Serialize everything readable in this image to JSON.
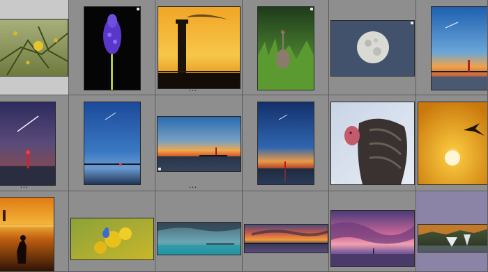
{
  "grid": {
    "cells": [
      {
        "header": "",
        "dots": ""
      },
      {
        "header": "",
        "dots": ""
      },
      {
        "header": "",
        "dots": "•••"
      },
      {
        "header": "",
        "dots": ""
      },
      {
        "header": "",
        "dots": ""
      },
      {
        "header": "",
        "dots": ""
      },
      {
        "header": "",
        "dots": "•••"
      },
      {
        "header": "",
        "dots": ""
      },
      {
        "header": "",
        "dots": "•••"
      },
      {
        "header": "",
        "dots": ""
      },
      {
        "header": "",
        "dots": ""
      },
      {
        "header": "",
        "dots": ""
      },
      {
        "header": "",
        "dots": ""
      },
      {
        "header": "",
        "dots": ""
      },
      {
        "header": "",
        "dots": ""
      },
      {
        "header": "",
        "dots": ""
      },
      {
        "header": "",
        "dots": ""
      },
      {
        "header": "",
        "dots": ""
      }
    ],
    "photos": [
      "yellow-flowers-branch",
      "purple-grape-hyacinth",
      "lighthouse-silhouette-sunset",
      "sandhill-crane-in-grass",
      "full-moon-blue-sky",
      "lighthouse-with-comet-dusk",
      "comet-over-red-lighthouse",
      "comet-blue-twilight",
      "lighthouse-horizon-sunset",
      "pier-lighthouse-twilight",
      "turkey-vulture",
      "bird-flying-over-sun",
      "swimmer-at-sunset",
      "bluebird-in-sunflowers",
      "stormy-lake-pier",
      "sunset-lake-clouds",
      "purple-sunset-clouds",
      "waterfall-landscape"
    ]
  },
  "colors": {
    "cell_background": "#8e8e8e",
    "selected_cell": "#c9c9c9",
    "selected_cell_alt": "#8c84a6",
    "grid_gap": "#727272"
  }
}
